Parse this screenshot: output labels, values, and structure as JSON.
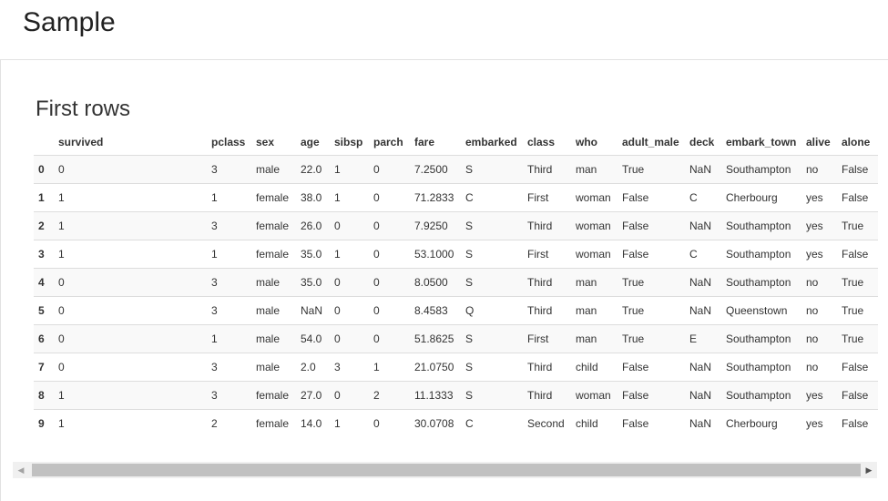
{
  "page": {
    "title": "Sample",
    "section_title": "First rows"
  },
  "table": {
    "columns": [
      "",
      "survived",
      "pclass",
      "sex",
      "age",
      "sibsp",
      "parch",
      "fare",
      "embarked",
      "class",
      "who",
      "adult_male",
      "deck",
      "embark_town",
      "alive",
      "alone"
    ],
    "rows": [
      [
        "0",
        "0",
        "3",
        "male",
        "22.0",
        "1",
        "0",
        "7.2500",
        "S",
        "Third",
        "man",
        "True",
        "NaN",
        "Southampton",
        "no",
        "False"
      ],
      [
        "1",
        "1",
        "1",
        "female",
        "38.0",
        "1",
        "0",
        "71.2833",
        "C",
        "First",
        "woman",
        "False",
        "C",
        "Cherbourg",
        "yes",
        "False"
      ],
      [
        "2",
        "1",
        "3",
        "female",
        "26.0",
        "0",
        "0",
        "7.9250",
        "S",
        "Third",
        "woman",
        "False",
        "NaN",
        "Southampton",
        "yes",
        "True"
      ],
      [
        "3",
        "1",
        "1",
        "female",
        "35.0",
        "1",
        "0",
        "53.1000",
        "S",
        "First",
        "woman",
        "False",
        "C",
        "Southampton",
        "yes",
        "False"
      ],
      [
        "4",
        "0",
        "3",
        "male",
        "35.0",
        "0",
        "0",
        "8.0500",
        "S",
        "Third",
        "man",
        "True",
        "NaN",
        "Southampton",
        "no",
        "True"
      ],
      [
        "5",
        "0",
        "3",
        "male",
        "NaN",
        "0",
        "0",
        "8.4583",
        "Q",
        "Third",
        "man",
        "True",
        "NaN",
        "Queenstown",
        "no",
        "True"
      ],
      [
        "6",
        "0",
        "1",
        "male",
        "54.0",
        "0",
        "0",
        "51.8625",
        "S",
        "First",
        "man",
        "True",
        "E",
        "Southampton",
        "no",
        "True"
      ],
      [
        "7",
        "0",
        "3",
        "male",
        "2.0",
        "3",
        "1",
        "21.0750",
        "S",
        "Third",
        "child",
        "False",
        "NaN",
        "Southampton",
        "no",
        "False"
      ],
      [
        "8",
        "1",
        "3",
        "female",
        "27.0",
        "0",
        "2",
        "11.1333",
        "S",
        "Third",
        "woman",
        "False",
        "NaN",
        "Southampton",
        "yes",
        "False"
      ],
      [
        "9",
        "1",
        "2",
        "female",
        "14.0",
        "1",
        "0",
        "30.0708",
        "C",
        "Second",
        "child",
        "False",
        "NaN",
        "Cherbourg",
        "yes",
        "False"
      ]
    ]
  },
  "scrollbar": {
    "left_arrow_icon": "◀",
    "right_arrow_icon": "▶",
    "position": 0
  }
}
